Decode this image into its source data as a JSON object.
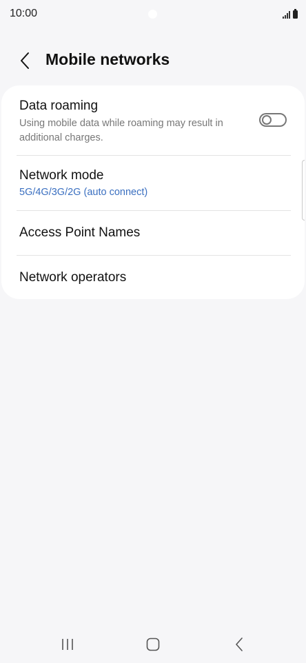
{
  "status_bar": {
    "time": "10:00",
    "signal_icon": "signal-icon",
    "battery_icon": "battery-icon"
  },
  "header": {
    "back_icon": "chevron-left-icon",
    "title": "Mobile networks"
  },
  "settings": {
    "items": [
      {
        "title": "Data roaming",
        "subtitle": "Using mobile data while roaming may result in additional charges.",
        "toggle": "off"
      },
      {
        "title": "Network mode",
        "subtitle": "5G/4G/3G/2G (auto connect)"
      },
      {
        "title": "Access Point Names"
      },
      {
        "title": "Network operators"
      }
    ]
  },
  "nav_bar": {
    "recents_icon": "recents-icon",
    "home_icon": "home-icon",
    "back_icon": "back-icon"
  },
  "colors": {
    "background": "#f6f6f8",
    "card": "#ffffff",
    "accent_blue": "#3a6fc0",
    "secondary_text": "#777777"
  }
}
